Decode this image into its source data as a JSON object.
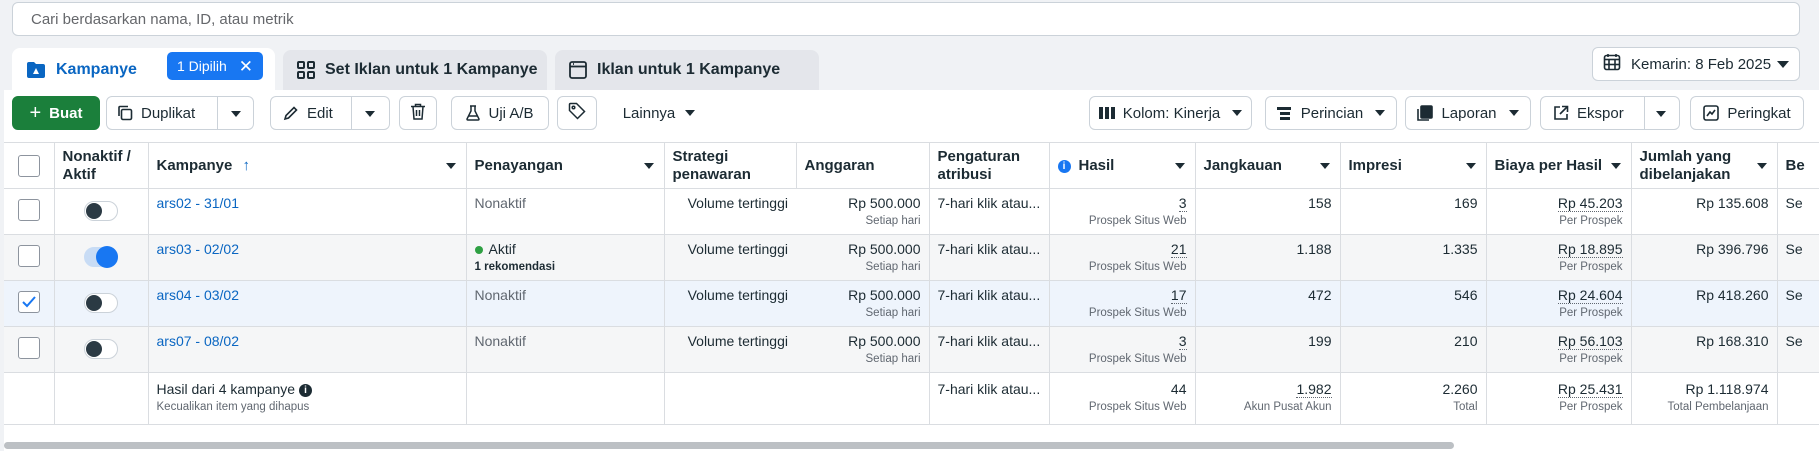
{
  "search": {
    "placeholder": "Cari berdasarkan nama, ID, atau metrik"
  },
  "tabs": {
    "campaigns": {
      "label": "Kampanye",
      "selected_badge": "1 Dipilih"
    },
    "adsets": {
      "label": "Set Iklan untuk 1 Kampanye"
    },
    "ads": {
      "label": "Iklan untuk 1 Kampanye"
    }
  },
  "date_range": {
    "label": "Kemarin: 8 Feb 2025"
  },
  "toolbar": {
    "create": "Buat",
    "duplicate": "Duplikat",
    "edit": "Edit",
    "ab_test": "Uji A/B",
    "more": "Lainnya",
    "columns": "Kolom: Kinerja",
    "breakdown": "Perincian",
    "reports": "Laporan",
    "export": "Ekspor",
    "rules": "Peringkat"
  },
  "columns": {
    "toggle": "Nonaktif / Aktif",
    "campaign": "Kampanye",
    "delivery": "Penayangan",
    "bid_strategy": "Strategi penawaran",
    "budget": "Anggaran",
    "attribution": "Pengaturan atribusi",
    "results": "Hasil",
    "reach": "Jangkauan",
    "impressions": "Impresi",
    "cost_per_result": "Biaya per Hasil",
    "amount_spent": "Jumlah yang dibelanjakan",
    "next": "Be"
  },
  "rows": [
    {
      "name": "ars02 - 31/01",
      "active": false,
      "checked": false,
      "delivery": "Nonaktif",
      "reco": "",
      "bid": "Volume tertinggi",
      "budget": "Rp 500.000",
      "budget_sub": "Setiap hari",
      "attribution": "7-hari klik atau...",
      "results": "3",
      "results_sub": "Prospek Situs Web",
      "reach": "158",
      "impressions": "169",
      "cpr": "Rp 45.203",
      "cpr_sub": "Per Prospek",
      "spent": "Rp 135.608",
      "next": "Se"
    },
    {
      "name": "ars03 - 02/02",
      "active": true,
      "checked": false,
      "delivery": "Aktif",
      "reco": "1 rekomendasi",
      "bid": "Volume tertinggi",
      "budget": "Rp 500.000",
      "budget_sub": "Setiap hari",
      "attribution": "7-hari klik atau...",
      "results": "21",
      "results_sub": "Prospek Situs Web",
      "reach": "1.188",
      "impressions": "1.335",
      "cpr": "Rp 18.895",
      "cpr_sub": "Per Prospek",
      "spent": "Rp 396.796",
      "next": "Se"
    },
    {
      "name": "ars04 - 03/02",
      "active": false,
      "checked": true,
      "delivery": "Nonaktif",
      "reco": "",
      "bid": "Volume tertinggi",
      "budget": "Rp 500.000",
      "budget_sub": "Setiap hari",
      "attribution": "7-hari klik atau...",
      "results": "17",
      "results_sub": "Prospek Situs Web",
      "reach": "472",
      "impressions": "546",
      "cpr": "Rp 24.604",
      "cpr_sub": "Per Prospek",
      "spent": "Rp 418.260",
      "next": "Se"
    },
    {
      "name": "ars07 - 08/02",
      "active": false,
      "checked": false,
      "delivery": "Nonaktif",
      "reco": "",
      "bid": "Volume tertinggi",
      "budget": "Rp 500.000",
      "budget_sub": "Setiap hari",
      "attribution": "7-hari klik atau...",
      "results": "3",
      "results_sub": "Prospek Situs Web",
      "reach": "199",
      "impressions": "210",
      "cpr": "Rp 56.103",
      "cpr_sub": "Per Prospek",
      "spent": "Rp 168.310",
      "next": "Se"
    }
  ],
  "summary": {
    "title": "Hasil dari 4 kampanye",
    "subtitle": "Kecualikan item yang dihapus",
    "attribution": "7-hari klik atau...",
    "results": "44",
    "results_sub": "Prospek Situs Web",
    "reach": "1.982",
    "reach_sub": "Akun Pusat Akun",
    "impressions": "2.260",
    "impressions_sub": "Total",
    "cpr": "Rp 25.431",
    "cpr_sub": "Per Prospek",
    "spent": "Rp 1.118.974",
    "spent_sub": "Total Pembelanjaan"
  },
  "colors": {
    "accent": "#1877f2",
    "create_button": "#1b7f3b",
    "active_dot": "#2ea043"
  }
}
